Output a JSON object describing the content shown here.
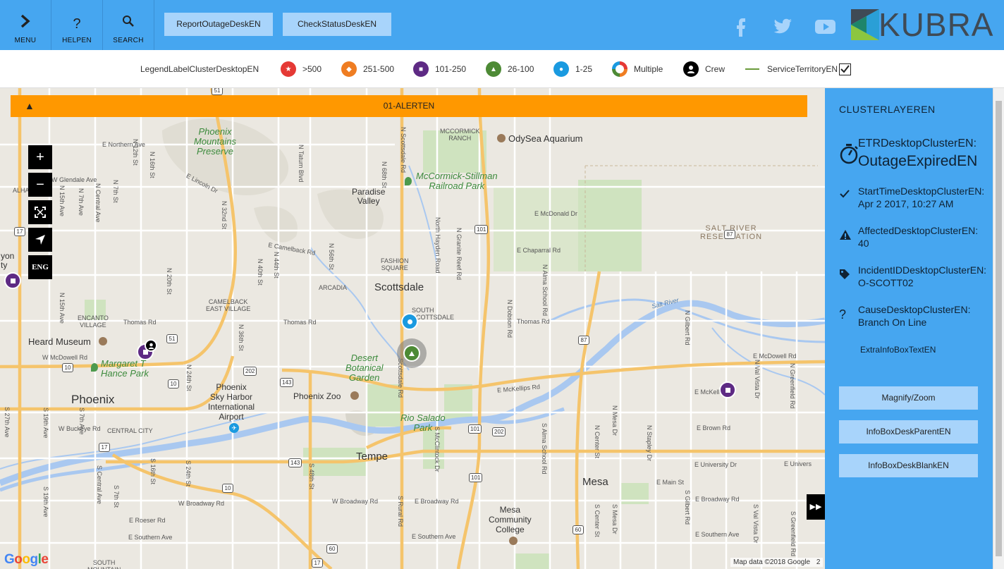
{
  "topbar": {
    "menu_label": "MENU",
    "help_label": "HELPEN",
    "search_label": "SEARCH",
    "report_button": "ReportOutageDeskEN",
    "check_button": "CheckStatusDeskEN",
    "social": [
      "facebook-icon",
      "twitter-icon",
      "youtube-icon"
    ],
    "logo_text": "KUBRA",
    "colors": {
      "bar": "#46a6f0",
      "button": "#a8d4fb"
    }
  },
  "legend": {
    "title": "LegendLabelClusterDesktopEN",
    "items": [
      {
        "label": ">500",
        "color": "#e53935",
        "icon": "star-icon"
      },
      {
        "label": "251-500",
        "color": "#ef7d22",
        "icon": "diamond-icon"
      },
      {
        "label": "101-250",
        "color": "#5e2a84",
        "icon": "square-icon"
      },
      {
        "label": "26-100",
        "color": "#4d8a35",
        "icon": "triangle-icon"
      },
      {
        "label": "1-25",
        "color": "#1a9ae0",
        "icon": "circle-icon"
      },
      {
        "label": "Multiple",
        "color": "#e53935",
        "icon": "multi-ring-icon"
      },
      {
        "label": "Crew",
        "color": "#000000",
        "icon": "crew-icon"
      },
      {
        "label": "ServiceTerritoryEN",
        "color": "#6a9a3a",
        "icon": "line-icon",
        "checked": true
      }
    ]
  },
  "map": {
    "alert_text": "01-ALERTEN",
    "language_button": "ENG",
    "controls": [
      "zoom-in",
      "zoom-out",
      "fullscreen",
      "locate"
    ],
    "attribution": "Map data ©2018 Google",
    "attribution_tail": "2",
    "google": "Google",
    "cities": {
      "phoenix": "Phoenix",
      "scottsdale": "Scottsdale",
      "tempe": "Tempe",
      "mesa": "Mesa",
      "paradise_valley": "Paradise\nValley",
      "salt_river": "SALT RIVER\nRESERVATION",
      "fashion_square": "FASHION\nSQUARE",
      "arcadia": "ARCADIA",
      "camelback_east": "CAMELBACK\nEAST VILLAGE",
      "encanto": "ENCANTO\nVILLAGE",
      "central_city": "CENTRAL CITY",
      "south_scottsdale": "SOUTH\nSCOTTSDALE",
      "mccormick_ranch": "MCCORMICK\nRANCH",
      "alha": "ALHA",
      "yon": "yon",
      "ty": "ty",
      "south_mountain": "SOUTH\nMOUNTAIN"
    },
    "pois": {
      "phoenix_mountains": "Phoenix\nMountains\nPreserve",
      "mccormick_stillman": "McCormick-Stillman\nRailroad Park",
      "odysea": "OdySea Aquarium",
      "heard_museum": "Heard Museum",
      "margaret_hance": "Margaret T\nHance Park",
      "desert_botanical": "Desert\nBotanical\nGarden",
      "phoenix_zoo": "Phoenix Zoo",
      "airport": "Phoenix\nSky Harbor\nInternational\nAirport",
      "rio_salado": "Rio Salado\nPark",
      "mesa_cc": "Mesa\nCommunity\nCollege",
      "salt_river_label": "Salt River"
    },
    "streets": {
      "e_northern": "E Northern Ave",
      "w_glendale": "W Glendale Ave",
      "e_lincoln": "E Lincoln Dr",
      "e_camelback": "E Camelback Rd",
      "thomas_w": "Thomas Rd",
      "thomas_c": "Thomas Rd",
      "thomas_e": "Thomas Rd",
      "e_mcdonald": "E McDonald Dr",
      "e_chaparral": "E Chaparral Rd",
      "w_mcdowell": "W McDowell Rd",
      "e_mcdowell": "E McDowell Rd",
      "e_mckellips": "E McKellips Rd",
      "e_mckell2": "E McKell",
      "e_brown": "E Brown Rd",
      "e_university": "E University Dr",
      "e_univers2": "E Univers",
      "e_main": "E Main St",
      "w_broadway": "W Broadway Rd",
      "w_broadway2": "W Broadway Rd",
      "e_broadway": "E Broadway Rd",
      "e_broadway2": "E Broadway Rd",
      "w_buckeye": "W Buckeye Rd",
      "e_roeser": "E Roeser Rd",
      "e_southern": "E Southern Ave",
      "e_southern2": "E Southern Ave",
      "e_southern3": "E Southern Ave",
      "n_tatum": "N Tatum Blvd",
      "n_32nd": "N 32nd St",
      "n_40th": "N 40th St",
      "n_44th": "N 44th St",
      "n_56th": "N 56th St",
      "n_68th": "N 68th St",
      "n_scottsdale": "N Scottsdale Rd",
      "n_hayden": "North Hayden Road",
      "n_granite": "N Granite Reef Rd",
      "n_alma": "N Alma School Rd",
      "n_dobson": "N Dobson Rd",
      "n_mesa": "N Mesa Dr",
      "n_center": "N Center St",
      "n_stapley": "N Stapley Dr",
      "n_gilbert": "N Gilbert Rd",
      "n_val_vista": "N Val Vista Dr",
      "n_greenfield": "N Greenfield Rd",
      "n_12th": "N 12th St",
      "n_16th": "N 16th St",
      "n_20th": "N 20th St",
      "n_24th": "N 24th St",
      "n_36th": "N 36th St",
      "n_7th": "N 7th Ave",
      "n_15th": "N 15th Ave",
      "n_central": "N Central Ave",
      "n_7th_st": "N 7th St",
      "n_15th_ave2": "N 15th Ave",
      "s_27th": "S 27th Ave",
      "s_19th": "S 19th Ave",
      "s_7th": "S 7th Ave",
      "s_central": "S Central Ave",
      "s_16th": "S 16th St",
      "s_24th": "S 24th St",
      "s_48th": "S 48th St",
      "s_rural": "S Rural Rd",
      "s_mcclintock": "S McClintock Dr",
      "s_alma": "S Alma School Rd",
      "s_mesa": "S Mesa Dr",
      "s_center": "S Center St",
      "s_gilbert": "S Gilbert Rd",
      "s_val_vista": "S Val Vista Dr",
      "s_scottsdale": "Scottsdale Rd",
      "s_19th_ave": "S 19th Ave",
      "s_7th_st": "S 7th St",
      "s_greenfield": "S Greenfield Rd"
    },
    "shields": [
      "51",
      "17",
      "10",
      "202",
      "143",
      "101",
      "87",
      "60",
      "17",
      "143",
      "101",
      "202",
      "10",
      "60",
      "51",
      "87",
      "101",
      "10",
      "17"
    ]
  },
  "sidepanel": {
    "title": "CLUSTERLAYEREN",
    "etr_label": "ETRDesktopClusterEN:",
    "etr_value": "OutageExpiredEN",
    "start_label": "StartTimeDesktopClusterEN:",
    "start_value": "Apr 2 2017, 10:27 AM",
    "affected_label": "AffectedDesktopClusterEN:",
    "affected_value": "40",
    "incident_label": "IncidentIDDesktopClusterEN:",
    "incident_value": "O-SCOTT02",
    "cause_label": "CauseDesktopClusterEN:",
    "cause_value": "Branch On Line",
    "extra": "ExtraInfoBoxTextEN",
    "buttons": [
      "Magnify/Zoom",
      "InfoBoxDeskParentEN",
      "InfoBoxDeskBlankEN"
    ]
  }
}
